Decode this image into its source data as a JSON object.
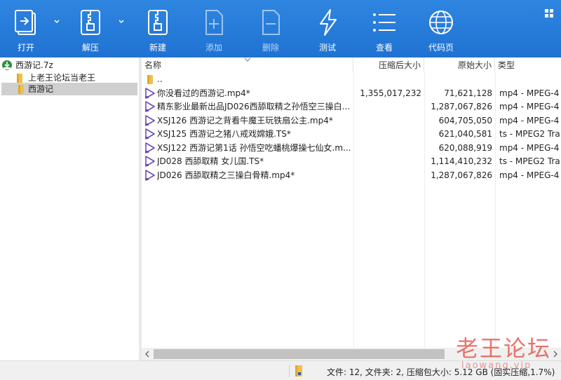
{
  "toolbar": {
    "buttons": [
      {
        "label": "打开",
        "icon": "open-icon",
        "enabled": true
      },
      {
        "label": "解压",
        "icon": "extract-icon",
        "enabled": true
      },
      {
        "label": "新建",
        "icon": "new-archive-icon",
        "enabled": true
      },
      {
        "label": "添加",
        "icon": "add-icon",
        "enabled": false
      },
      {
        "label": "删除",
        "icon": "delete-icon",
        "enabled": false
      },
      {
        "label": "测试",
        "icon": "test-icon",
        "enabled": true
      },
      {
        "label": "查看",
        "icon": "view-icon",
        "enabled": true
      },
      {
        "label": "代码页",
        "icon": "codepage-icon",
        "enabled": true
      }
    ]
  },
  "tree": {
    "archive": "西游记.7z",
    "folders": [
      "上老王论坛当老王",
      "西游记"
    ],
    "selected": "西游记"
  },
  "list": {
    "columns": {
      "name": "名称",
      "packed": "压缩后大小",
      "size": "原始大小",
      "type": "类型"
    },
    "rows": [
      {
        "icon": "folder-icon",
        "name": "..",
        "packed": "",
        "size": "",
        "type": ""
      },
      {
        "icon": "video-file-icon",
        "name": "你没看过的西游记.mp4*",
        "packed": "1,355,017,232",
        "size": "71,621,128",
        "type": "mp4 - MPEG-4"
      },
      {
        "icon": "video-file-icon",
        "name": "精东影业最新出品JD026西舔取精之孙悟空三操白...",
        "packed": "",
        "size": "1,287,067,826",
        "type": "mp4 - MPEG-4"
      },
      {
        "icon": "video-file-icon",
        "name": "XSJ126 西游记之背看牛魔王玩铁扇公主.mp4*",
        "packed": "",
        "size": "604,705,050",
        "type": "mp4 - MPEG-4"
      },
      {
        "icon": "video-file-icon",
        "name": "XSJ125 西游记之猪八戒戏嫦娥.TS*",
        "packed": "",
        "size": "621,040,581",
        "type": "ts - MPEG2 Tra"
      },
      {
        "icon": "video-file-icon",
        "name": "XSJ122 西游记第1话 孙悟空吃蟠桃爆操七仙女.m...",
        "packed": "",
        "size": "620,088,919",
        "type": "mp4 - MPEG-4"
      },
      {
        "icon": "video-file-icon",
        "name": "JD028 西舔取精 女儿国.TS*",
        "packed": "",
        "size": "1,114,410,232",
        "type": "ts - MPEG2 Tra"
      },
      {
        "icon": "video-file-icon",
        "name": "JD026 西舔取精之三操白骨精.mp4*",
        "packed": "",
        "size": "1,287,067,826",
        "type": "mp4 - MPEG-4"
      }
    ]
  },
  "status": {
    "text": "文件: 12, 文件夹: 2, 压缩包大小: 5.12 GB (固实压缩,1.7%)"
  },
  "watermark": {
    "title": "老王论坛",
    "sub": "laowang.vip"
  },
  "colors": {
    "toolbar": "#1f72d2",
    "selection": "#cfcfcf",
    "folder": "#f2c048",
    "video": "#6f4bb8"
  }
}
